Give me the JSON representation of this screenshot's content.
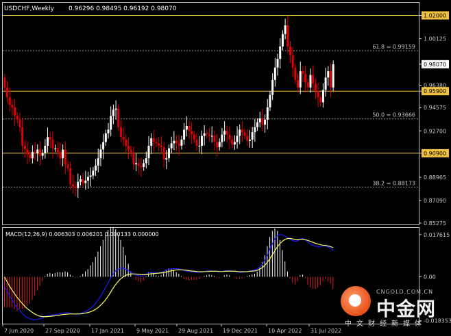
{
  "header": {
    "symbol": "USDCHF,Weekly",
    "ohlc": "0.96296 0.98495 0.96192 0.98070"
  },
  "macd": {
    "label": "MACD(12,26,9) 0.006303 0.006201 0.000133 0.000000"
  },
  "price_axis": {
    "ticks": [
      "1.02000",
      "1.00125",
      "0.98070",
      "0.96380",
      "0.95900",
      "0.94575",
      "0.92700",
      "0.90900",
      "0.88965",
      "0.87090",
      "0.85275"
    ],
    "highlighted": [
      "1.02000",
      "0.98070",
      "0.95900",
      "0.90900"
    ]
  },
  "macd_axis": {
    "ticks": [
      "0.017615",
      "0.00",
      "-0.018353"
    ]
  },
  "time_axis": {
    "labels": [
      "7 Jun 2020",
      "27 Sep 2020",
      "17 Jan 2021",
      "9 May 2021",
      "29 Aug 2021",
      "19 Dec 2021",
      "10 Apr 2022",
      "31 Jul 2022"
    ]
  },
  "fib_levels": [
    {
      "label": "61.8 = 0.99159",
      "price": 0.99159
    },
    {
      "label": "50.0 = 0.93666",
      "price": 0.93666
    },
    {
      "label": "38.2 = 0.88173",
      "price": 0.88173
    }
  ],
  "horizontal_lines": [
    1.02,
    0.959,
    0.909
  ],
  "colors": {
    "background": "#000000",
    "bull": "#ffffff",
    "bear": "#e00000",
    "level": "#f0c040",
    "fib": "#909090",
    "macd_line": "#1a1aff",
    "signal_line": "#ffff66",
    "hist_pos": "#ffffff",
    "hist_neg": "#dd2020",
    "axis": "#c8c8c8"
  },
  "watermark": {
    "site": "CNGOLD.COM.CN",
    "brand": "中金网",
    "sub": "中文财经新媒体"
  },
  "chart_data": {
    "type": "candlestick",
    "ylim": [
      0.85275,
      1.028
    ],
    "candles_close": [
      0.962,
      0.954,
      0.948,
      0.946,
      0.939,
      0.936,
      0.93,
      0.915,
      0.912,
      0.908,
      0.905,
      0.91,
      0.909,
      0.912,
      0.907,
      0.909,
      0.915,
      0.922,
      0.92,
      0.913,
      0.913,
      0.91,
      0.905,
      0.912,
      0.9,
      0.897,
      0.884,
      0.882,
      0.881,
      0.886,
      0.888,
      0.885,
      0.887,
      0.89,
      0.891,
      0.895,
      0.899,
      0.905,
      0.912,
      0.918,
      0.925,
      0.928,
      0.939,
      0.944,
      0.945,
      0.93,
      0.922,
      0.92,
      0.915,
      0.912,
      0.909,
      0.9,
      0.901,
      0.899,
      0.898,
      0.901,
      0.905,
      0.915,
      0.921,
      0.918,
      0.917,
      0.915,
      0.914,
      0.904,
      0.905,
      0.913,
      0.917,
      0.919,
      0.917,
      0.915,
      0.92,
      0.928,
      0.931,
      0.927,
      0.924,
      0.92,
      0.915,
      0.915,
      0.923,
      0.925,
      0.924,
      0.923,
      0.923,
      0.918,
      0.914,
      0.918,
      0.924,
      0.927,
      0.924,
      0.92,
      0.916,
      0.918,
      0.923,
      0.928,
      0.926,
      0.923,
      0.919,
      0.92,
      0.926,
      0.93,
      0.934,
      0.937,
      0.932,
      0.936,
      0.946,
      0.956,
      0.968,
      0.978,
      0.985,
      0.995,
      1.005,
      1.012,
      0.995,
      0.988,
      0.978,
      0.968,
      0.962,
      0.975,
      0.973,
      0.966,
      0.962,
      0.972,
      0.965,
      0.959,
      0.954,
      0.95,
      0.96,
      0.97,
      0.975,
      0.962,
      0.9807
    ],
    "series": [
      {
        "name": "MACD",
        "values": [
          -0.004,
          -0.006,
          -0.0078,
          -0.0095,
          -0.0112,
          -0.013,
          -0.014,
          -0.0152,
          -0.0163,
          -0.017,
          -0.0175,
          -0.0178,
          -0.018,
          -0.0178,
          -0.0176,
          -0.0172,
          -0.0166,
          -0.0162,
          -0.016,
          -0.016,
          -0.0158,
          -0.0156,
          -0.0154,
          -0.0152,
          -0.015,
          -0.015,
          -0.0152,
          -0.0154,
          -0.0156,
          -0.0156,
          -0.0154,
          -0.015,
          -0.0145,
          -0.014,
          -0.0132,
          -0.0124,
          -0.0112,
          -0.0098,
          -0.0082,
          -0.0064,
          -0.0045,
          -0.0025,
          -0.0005,
          0.0012,
          0.0025,
          0.0032,
          0.0036,
          0.0036,
          0.0032,
          0.0026,
          0.0018,
          0.0012,
          0.0008,
          0.0005,
          0.0003,
          0.0004,
          0.001,
          0.0016,
          0.0018,
          0.0017,
          0.0016,
          0.0016,
          0.0018,
          0.0022,
          0.0028,
          0.0032,
          0.0034,
          0.0035,
          0.0034,
          0.0033,
          0.003,
          0.0026,
          0.0024,
          0.0022,
          0.0021,
          0.002,
          0.0019,
          0.0019,
          0.002,
          0.0022,
          0.0024,
          0.0025,
          0.0025,
          0.0024,
          0.0022,
          0.0021,
          0.0022,
          0.0024,
          0.0026,
          0.0025,
          0.0024,
          0.0022,
          0.002,
          0.0019,
          0.0019,
          0.002,
          0.0022,
          0.0024,
          0.0026,
          0.0028,
          0.0032,
          0.004,
          0.0052,
          0.0068,
          0.009,
          0.0115,
          0.0138,
          0.0158,
          0.0172,
          0.0176,
          0.0175,
          0.017,
          0.0164,
          0.0158,
          0.0152,
          0.0148,
          0.015,
          0.0158,
          0.016,
          0.0155,
          0.0145,
          0.0138,
          0.0132,
          0.0128,
          0.0126,
          0.0126,
          0.0128,
          0.013,
          0.0125,
          0.012,
          0.011
        ]
      },
      {
        "name": "Signal",
        "values": [
          0.0,
          -0.002,
          -0.0038,
          -0.0055,
          -0.007,
          -0.0085,
          -0.0098,
          -0.011,
          -0.0122,
          -0.0132,
          -0.014,
          -0.0148,
          -0.0155,
          -0.016,
          -0.0164,
          -0.0166,
          -0.0167,
          -0.0166,
          -0.0165,
          -0.0164,
          -0.0163,
          -0.0162,
          -0.016,
          -0.0158,
          -0.0157,
          -0.0156,
          -0.0155,
          -0.0155,
          -0.0155,
          -0.0155,
          -0.0155,
          -0.0154,
          -0.0152,
          -0.015,
          -0.0147,
          -0.0143,
          -0.0138,
          -0.0131,
          -0.0122,
          -0.0112,
          -0.01,
          -0.0086,
          -0.007,
          -0.0053,
          -0.0037,
          -0.0023,
          -0.0012,
          -0.0003,
          0.0004,
          0.0009,
          0.0011,
          0.0012,
          0.0012,
          0.0011,
          0.001,
          0.0009,
          0.0009,
          0.001,
          0.0012,
          0.0013,
          0.0014,
          0.0015,
          0.0016,
          0.0017,
          0.0019,
          0.0021,
          0.0024,
          0.0026,
          0.0028,
          0.0029,
          0.0029,
          0.0029,
          0.0028,
          0.0027,
          0.0025,
          0.0024,
          0.0023,
          0.0022,
          0.0021,
          0.0021,
          0.0022,
          0.0022,
          0.0023,
          0.0023,
          0.0023,
          0.0023,
          0.0022,
          0.0022,
          0.0023,
          0.0023,
          0.0024,
          0.0023,
          0.0023,
          0.0022,
          0.0021,
          0.0021,
          0.0021,
          0.0022,
          0.0023,
          0.0024,
          0.0025,
          0.0028,
          0.0033,
          0.004,
          0.005,
          0.0063,
          0.0078,
          0.0095,
          0.0112,
          0.0128,
          0.014,
          0.015,
          0.0157,
          0.016,
          0.016,
          0.0158,
          0.0156,
          0.0156,
          0.0157,
          0.0157,
          0.0155,
          0.0152,
          0.0148,
          0.0144,
          0.014,
          0.0137,
          0.0134,
          0.0132,
          0.0131,
          0.0129,
          0.0126,
          0.0122
        ]
      }
    ]
  }
}
